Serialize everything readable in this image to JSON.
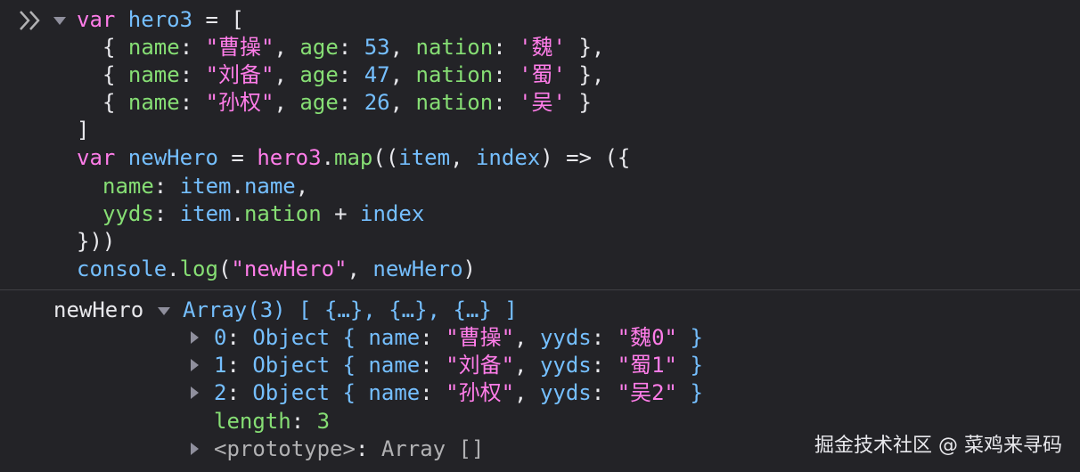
{
  "input": {
    "l1": {
      "kw": "var",
      "name": " hero3",
      "rest": " = ["
    },
    "rows": [
      {
        "name_key": "name",
        "name_val": "\"曹操\"",
        "age_key": "age",
        "age_val": "53",
        "nation_key": "nation",
        "nation_val": "'魏'",
        "end": " },"
      },
      {
        "name_key": "name",
        "name_val": "\"刘备\"",
        "age_key": "age",
        "age_val": "47",
        "nation_key": "nation",
        "nation_val": "'蜀'",
        "end": " },"
      },
      {
        "name_key": "name",
        "name_val": "\"孙权\"",
        "age_key": "age",
        "age_val": "26",
        "nation_key": "nation",
        "nation_val": "'吴'",
        "end": " }"
      }
    ],
    "close_bracket": "]",
    "l6": {
      "kw": "var",
      "name": " newHero",
      "eq": " = ",
      "obj": "hero3",
      "dot": ".",
      "fn": "map",
      "open": "((",
      "p1": "item",
      "comma": ", ",
      "p2": "index",
      "arrow": ") => ({"
    },
    "l7": {
      "key": "name",
      "colon": ": ",
      "obj": "item",
      "dot": ".",
      "prop": "name",
      "end": ","
    },
    "l8": {
      "key": "yyds",
      "colon": ": ",
      "obj": "item",
      "dot": ".",
      "prop": "nation",
      "plus": " + ",
      "var": "index"
    },
    "l9": "}))",
    "l10": {
      "obj": "console",
      "dot": ".",
      "fn": "log",
      "open": "(",
      "str": "\"newHero\"",
      "comma": ", ",
      "var": "newHero",
      "close": ")"
    }
  },
  "output": {
    "label": "newHero",
    "array_type": "Array(3)",
    "array_preview": "[ {…}, {…}, {…} ]",
    "items": [
      {
        "index": "0",
        "type": "Object",
        "name_val": "\"曹操\"",
        "yyds_val": "\"魏0\""
      },
      {
        "index": "1",
        "type": "Object",
        "name_val": "\"刘备\"",
        "yyds_val": "\"蜀1\""
      },
      {
        "index": "2",
        "type": "Object",
        "name_val": "\"孙权\"",
        "yyds_val": "\"吴2\""
      }
    ],
    "length_key": "length",
    "length_val": "3",
    "prototype_key": "<prototype>",
    "prototype_val": "Array []"
  },
  "labels": {
    "key_name": "name",
    "key_yyds": "yyds",
    "colon": ": ",
    "open_brace": " { ",
    "close_brace": " }",
    "comma": ", "
  },
  "watermark": "掘金技术社区 @ 菜鸡来寻码"
}
